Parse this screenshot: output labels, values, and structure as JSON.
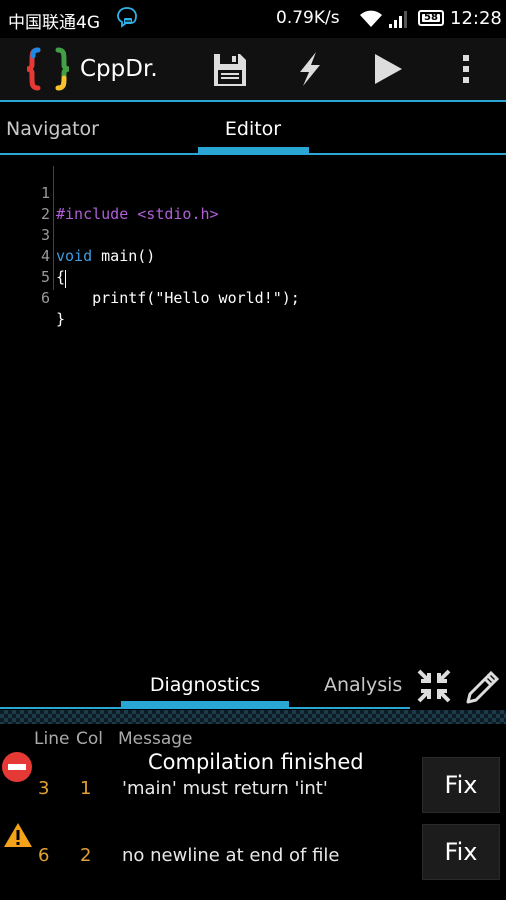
{
  "status_bar": {
    "carrier": "中国联通4G",
    "network_speed": "0.79K/s",
    "battery_level": "58",
    "time": "12:28"
  },
  "action_bar": {
    "title": "CppDr.",
    "icons": [
      "app-logo-icon",
      "save-icon",
      "compile-icon",
      "run-icon",
      "overflow-menu-icon"
    ]
  },
  "tabs": [
    {
      "label": "Navigator",
      "selected": false
    },
    {
      "label": "Editor",
      "selected": true
    }
  ],
  "editor": {
    "lines": [
      {
        "num": "1",
        "text": "#include <stdio.h>"
      },
      {
        "num": "2",
        "text": ""
      },
      {
        "num": "3",
        "text": "void main()"
      },
      {
        "num": "4",
        "text": "{"
      },
      {
        "num": "5",
        "text": "    printf(\"Hello world!\");"
      },
      {
        "num": "6",
        "text": "}"
      }
    ]
  },
  "bottom_panel": {
    "tabs": [
      {
        "label": "Diagnostics",
        "selected": true
      },
      {
        "label": "Analysis",
        "selected": false
      }
    ],
    "columns": [
      "Line",
      "Col",
      "Message"
    ],
    "toast": "Compilation finished",
    "rows": [
      {
        "severity": "error",
        "line": "3",
        "col": "1",
        "message": "'main' must return 'int'",
        "action": "Fix"
      },
      {
        "severity": "warning",
        "line": "6",
        "col": "2",
        "message": "no newline at end of file",
        "action": "Fix"
      }
    ]
  },
  "colors": {
    "accent": "#29a6d4",
    "preprocessor": "#b05fd6",
    "keyword": "#3e9be0",
    "number": "#e3a133"
  }
}
